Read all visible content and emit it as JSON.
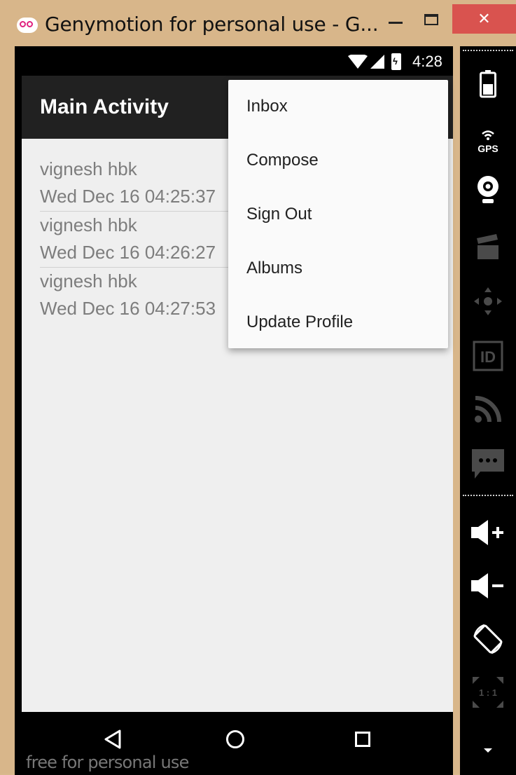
{
  "window": {
    "title": "Genymotion for personal use - G...",
    "close_glyph": "✕",
    "icons": [
      "genymotion-logo",
      "minimize-icon",
      "maximize-icon",
      "close-icon"
    ]
  },
  "status_bar": {
    "time": "4:28",
    "icons": [
      "wifi-icon",
      "signal-icon",
      "battery-charging-icon"
    ]
  },
  "app_bar": {
    "title": "Main Activity"
  },
  "messages": [
    {
      "sender": "vignesh hbk",
      "timestamp": "Wed Dec 16 04:25:37"
    },
    {
      "sender": "vignesh hbk",
      "timestamp": "Wed Dec 16 04:26:27"
    },
    {
      "sender": "vignesh hbk",
      "timestamp": "Wed Dec 16 04:27:53"
    }
  ],
  "overflow_menu": {
    "items": [
      "Inbox",
      "Compose",
      "Sign Out",
      "Albums",
      "Update Profile"
    ]
  },
  "nav_bar": {
    "icons": [
      "back-icon",
      "home-icon",
      "recent-apps-icon"
    ],
    "watermark": "free for personal use"
  },
  "toolbar": {
    "gps_label": "GPS",
    "id_label": "ID",
    "pixel_label": "1 : 1",
    "icons": [
      "battery-icon",
      "gps-icon",
      "webcam-icon",
      "screencast-icon",
      "dpad-icon",
      "device-id-icon",
      "rss-icon",
      "sms-icon",
      "volume-up-icon",
      "volume-down-icon",
      "rotate-icon",
      "pixel-perfect-icon",
      "more-icon"
    ]
  },
  "colors": {
    "frame": "#d8b68a",
    "close_button": "#d9534f",
    "app_bar": "#212121",
    "content_bg": "#efefef",
    "menu_bg": "#fafafa",
    "list_text": "#7d7d7d",
    "logo_accent": "#e0217e"
  }
}
